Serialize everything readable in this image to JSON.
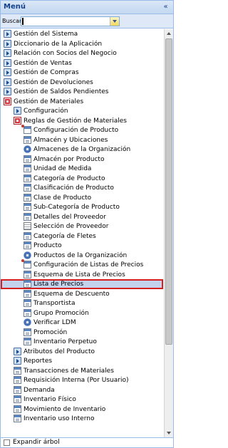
{
  "header": {
    "title": "Menú",
    "collapse_icon": "chevron-double-left-icon"
  },
  "search": {
    "label": "Buscar",
    "value": "",
    "placeholder": ""
  },
  "tree": [
    {
      "label": "Gestión del Sistema",
      "level": 0,
      "icon": "folder-closed"
    },
    {
      "label": "Diccionario de la Aplicación",
      "level": 0,
      "icon": "folder-closed"
    },
    {
      "label": "Relación con Socios del Negocio",
      "level": 0,
      "icon": "folder-closed"
    },
    {
      "label": "Gestión de Ventas",
      "level": 0,
      "icon": "folder-closed"
    },
    {
      "label": "Gestión de Compras",
      "level": 0,
      "icon": "folder-closed"
    },
    {
      "label": "Gestión de Devoluciones",
      "level": 0,
      "icon": "folder-closed"
    },
    {
      "label": "Gestión de Saldos Pendientes",
      "level": 0,
      "icon": "folder-closed"
    },
    {
      "label": "Gestión de Materiales",
      "level": 0,
      "icon": "folder-open"
    },
    {
      "label": "Configuración",
      "level": 1,
      "icon": "folder-closed"
    },
    {
      "label": "Reglas de Gestión de Materiales",
      "level": 1,
      "icon": "folder-open"
    },
    {
      "label": "Configuración de Producto",
      "level": 2,
      "icon": "workflow"
    },
    {
      "label": "Almacén y Ubicaciones",
      "level": 2,
      "icon": "window"
    },
    {
      "label": "Almacenes de la Organización",
      "level": 2,
      "icon": "process"
    },
    {
      "label": "Almacén por Producto",
      "level": 2,
      "icon": "window"
    },
    {
      "label": "Unidad de Medida",
      "level": 2,
      "icon": "window"
    },
    {
      "label": "Categoría de Producto",
      "level": 2,
      "icon": "window"
    },
    {
      "label": "Clasificación de Producto",
      "level": 2,
      "icon": "window"
    },
    {
      "label": "Clase de Producto",
      "level": 2,
      "icon": "window"
    },
    {
      "label": "Sub-Categoría de Producto",
      "level": 2,
      "icon": "window"
    },
    {
      "label": "Detalles del Proveedor",
      "level": 2,
      "icon": "window"
    },
    {
      "label": "Selección de Proveedor",
      "level": 2,
      "icon": "report"
    },
    {
      "label": "Categoría de Fletes",
      "level": 2,
      "icon": "window"
    },
    {
      "label": "Producto",
      "level": 2,
      "icon": "window"
    },
    {
      "label": "Productos de la Organización",
      "level": 2,
      "icon": "process"
    },
    {
      "label": "Configuración de Listas de Precios",
      "level": 2,
      "icon": "workflow"
    },
    {
      "label": "Esquema de Lista de Precios",
      "level": 2,
      "icon": "window"
    },
    {
      "label": "Lista de Precios",
      "level": 2,
      "icon": "window",
      "selected": true
    },
    {
      "label": "Esquema de Descuento",
      "level": 2,
      "icon": "window"
    },
    {
      "label": "Transportista",
      "level": 2,
      "icon": "window"
    },
    {
      "label": "Grupo Promoción",
      "level": 2,
      "icon": "window"
    },
    {
      "label": "Verificar LDM",
      "level": 2,
      "icon": "process"
    },
    {
      "label": "Promoción",
      "level": 2,
      "icon": "window"
    },
    {
      "label": "Inventario Perpetuo",
      "level": 2,
      "icon": "window"
    },
    {
      "label": "Atributos del Producto",
      "level": 1,
      "icon": "folder-closed"
    },
    {
      "label": "Reportes",
      "level": 1,
      "icon": "folder-closed"
    },
    {
      "label": "Transacciones de Materiales",
      "level": 1,
      "icon": "window"
    },
    {
      "label": "Requisición Interna (Por Usuario)",
      "level": 1,
      "icon": "window"
    },
    {
      "label": "Demanda",
      "level": 1,
      "icon": "window"
    },
    {
      "label": "Inventario Físico",
      "level": 1,
      "icon": "window"
    },
    {
      "label": "Movimiento de Inventario",
      "level": 1,
      "icon": "window"
    },
    {
      "label": "Inventario uso Interno",
      "level": 1,
      "icon": "window"
    }
  ],
  "footer": {
    "expand_label": "Expandir árbol",
    "checked": false
  },
  "colors": {
    "selected_border": "#d61e1e",
    "selected_bg": "#c3d3ee",
    "header_text": "#15428b"
  }
}
